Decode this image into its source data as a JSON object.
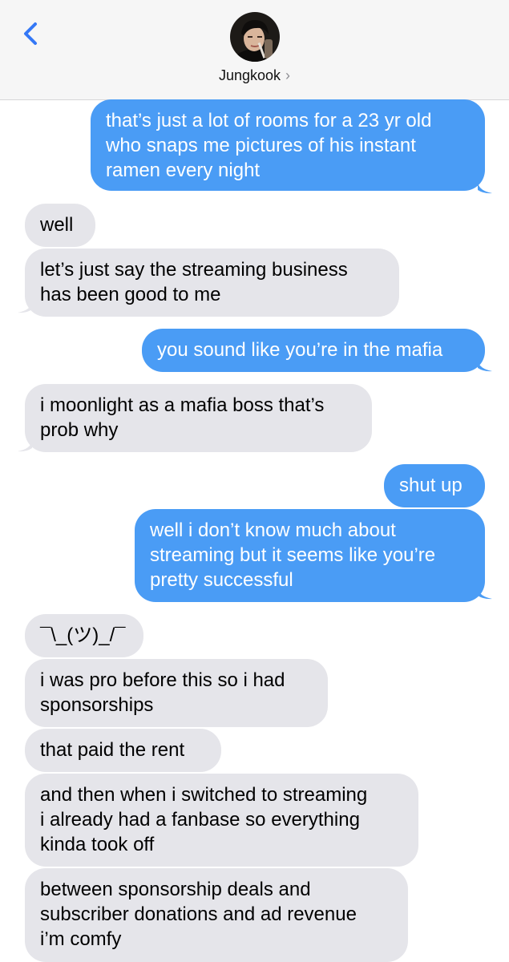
{
  "header": {
    "back_icon": "chevron-left-icon",
    "contact_name": "Jungkook",
    "contact_chevron": "›"
  },
  "colors": {
    "outgoing_bubble": "#4a9cf5",
    "incoming_bubble": "#e5e5ea",
    "accent": "#3478f6"
  },
  "messages": [
    {
      "direction": "outgoing",
      "text": "that’s just a lot of rooms for a 23 yr old\nwho snaps me pictures of his instant\nramen every night"
    },
    {
      "direction": "incoming",
      "text": "well"
    },
    {
      "direction": "incoming",
      "text": "let’s just say the streaming business\nhas been good to me"
    },
    {
      "direction": "outgoing",
      "text": "you sound like you’re in the mafia"
    },
    {
      "direction": "incoming",
      "text": "i moonlight as a mafia boss that’s\nprob why"
    },
    {
      "direction": "outgoing",
      "text": "shut up"
    },
    {
      "direction": "outgoing",
      "text": "well i don’t know much about\nstreaming but it seems like you’re\npretty successful"
    },
    {
      "direction": "incoming",
      "text": "¯\\_(ツ)_/¯"
    },
    {
      "direction": "incoming",
      "text": "i was pro before this so i had\nsponsorships"
    },
    {
      "direction": "incoming",
      "text": "that paid the rent"
    },
    {
      "direction": "incoming",
      "text": "and then when i switched to streaming\ni already had a fanbase so everything\nkinda took off"
    },
    {
      "direction": "incoming",
      "text": "between sponsorship deals and\nsubscriber donations and ad revenue\ni’m comfy"
    }
  ]
}
